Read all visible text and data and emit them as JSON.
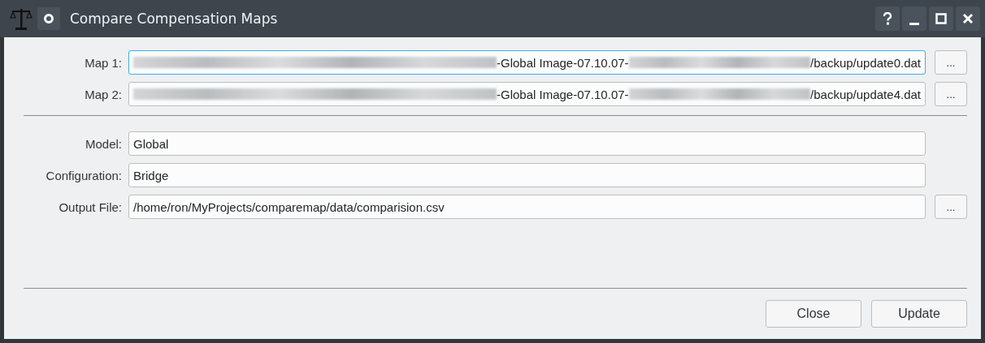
{
  "window": {
    "title": "Compare Compensation Maps"
  },
  "map_fields": [
    {
      "label": "Map 1:",
      "focused": true,
      "value_parts": [
        {
          "kind": "blurred"
        },
        {
          "kind": "text",
          "text": "-Global Image-07.10.07-"
        },
        {
          "kind": "blurred"
        },
        {
          "kind": "text",
          "text": "/backup/update0.dat"
        }
      ],
      "browse_label": "..."
    },
    {
      "label": "Map 2:",
      "focused": false,
      "value_parts": [
        {
          "kind": "blurred"
        },
        {
          "kind": "text",
          "text": "-Global Image-07.10.07-"
        },
        {
          "kind": "blurred"
        },
        {
          "kind": "text",
          "text": "/backup/update4.dat"
        }
      ],
      "browse_label": "..."
    }
  ],
  "fields": [
    {
      "label": "Model:",
      "value": "Global"
    },
    {
      "label": "Configuration:",
      "value": "Bridge"
    },
    {
      "label": "Output File:",
      "value": "/home/ron/MyProjects/comparemap/data/comparision.csv",
      "browse_label": "..."
    }
  ],
  "buttons": [
    "Close",
    "Update"
  ]
}
